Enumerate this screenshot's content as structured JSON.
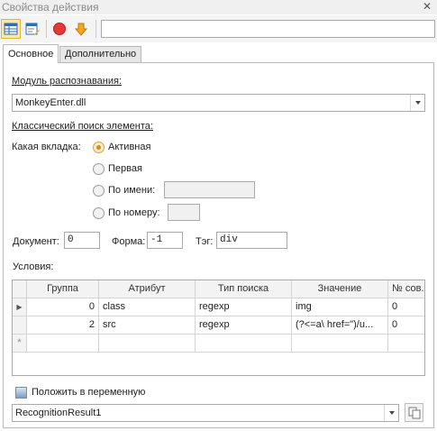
{
  "window": {
    "title": "Свойства действия"
  },
  "toolbar": {
    "search_value": ""
  },
  "tabs": [
    {
      "label": "Основное",
      "selected": true
    },
    {
      "label": "Дополнительно",
      "selected": false
    }
  ],
  "module": {
    "label": "Модуль распознавания:",
    "value": "MonkeyEnter.dll"
  },
  "search": {
    "label": "Классический поиск элемента:",
    "tab_label": "Какая вкладка:",
    "options": {
      "active": "Активная",
      "first": "Первая",
      "by_name": "По имени:",
      "by_number": "По номеру:"
    },
    "selected_option": "Активная",
    "by_name_value": "",
    "by_number_value": ""
  },
  "document": {
    "label": "Документ:",
    "value": "0"
  },
  "form": {
    "label": "Форма:",
    "value": "-1"
  },
  "tag": {
    "label": "Тэг:",
    "value": "div"
  },
  "conditions": {
    "label": "Условия:",
    "columns": [
      "Группа",
      "Атрибут",
      "Тип поиска",
      "Значение",
      "№ сов..."
    ],
    "rows": [
      {
        "group": "0",
        "attribute": "class",
        "search_type": "regexp",
        "value": "img",
        "match_no": "0"
      },
      {
        "group": "2",
        "attribute": "src",
        "search_type": "regexp",
        "value": "(?<=a\\ href=\")/u...",
        "match_no": "0"
      }
    ],
    "new_row_marker": "*"
  },
  "store": {
    "label": "Положить в переменную",
    "checked": true,
    "value": "RecognitionResult1"
  },
  "colors": {
    "accent": "#e5b43c",
    "radio_dot": "#d98d12",
    "stop": "#e53935",
    "arrow": "#f5a623"
  }
}
